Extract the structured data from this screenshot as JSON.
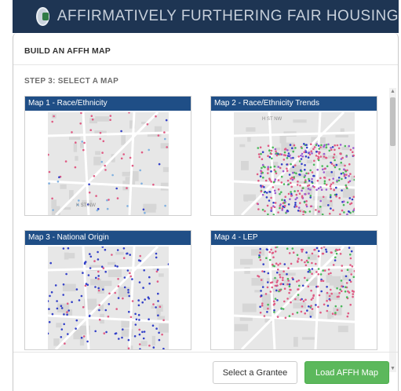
{
  "banner": {
    "title": "AFFIRMATIVELY FURTHERING FAIR HOUSING"
  },
  "modal": {
    "title": "BUILD AN AFFH MAP",
    "step_label": "STEP 3: SELECT A MAP",
    "cards": [
      {
        "label": "Map 1 - Race/Ethnicity",
        "street_label": "K ST NW",
        "dot_colors": [
          "#e05b84",
          "#e05b84",
          "#7fb0e0",
          "#3340c8",
          "#e05b84"
        ]
      },
      {
        "label": "Map 2 - Race/Ethnicity Trends",
        "street_label": "H ST NW",
        "dot_colors": [
          "#e05b84",
          "#3340c8",
          "#49b85a",
          "#e05b84",
          "#9a5bd1"
        ]
      },
      {
        "label": "Map 3 - National Origin",
        "street_label": "",
        "dot_colors": [
          "#3340c8",
          "#3340c8",
          "#3340c8",
          "#e05b84",
          "#3340c8"
        ]
      },
      {
        "label": "Map 4 - LEP",
        "street_label": "",
        "dot_colors": [
          "#e05b84",
          "#49b85a",
          "#3340c8",
          "#e05b84",
          "#e05b84"
        ]
      }
    ],
    "buttons": {
      "select_grantee": "Select a Grantee",
      "load_map": "Load AFFH Map"
    }
  }
}
